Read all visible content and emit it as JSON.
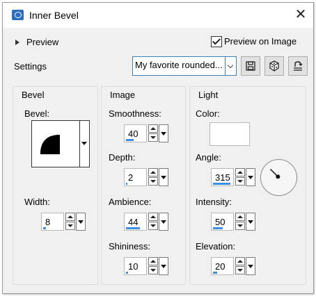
{
  "window": {
    "title": "Inner Bevel"
  },
  "header": {
    "preview_label": "Preview",
    "preview_on_image_label": "Preview on Image",
    "preview_on_image_checked": true
  },
  "settings": {
    "label": "Settings",
    "preset": "My favorite rounded..."
  },
  "toolbar": [
    "save-icon",
    "randomize-icon",
    "reset-icon"
  ],
  "bevel": {
    "title": "Bevel",
    "bevel_label": "Bevel:",
    "width_label": "Width:",
    "width_value": "8",
    "width_fill": 0.15
  },
  "image": {
    "title": "Image",
    "smoothness_label": "Smoothness:",
    "smoothness_value": "40",
    "smoothness_fill": 0.4,
    "depth_label": "Depth:",
    "depth_value": "2",
    "depth_fill": 0.08,
    "ambience_label": "Ambience:",
    "ambience_value": "44",
    "ambience_fill": 0.72,
    "shininess_label": "Shininess:",
    "shininess_value": "10",
    "shininess_fill": 0.12
  },
  "light": {
    "title": "Light",
    "color_label": "Color:",
    "color": "#ffffff",
    "angle_label": "Angle:",
    "angle_value": "315",
    "angle_fill": 0.88,
    "intensity_label": "Intensity:",
    "intensity_value": "50",
    "intensity_fill": 0.5,
    "elevation_label": "Elevation:",
    "elevation_value": "20",
    "elevation_fill": 0.2
  },
  "colors": {
    "accent": "#3a8ee6",
    "dialog_bg": "#f0f0f0"
  }
}
